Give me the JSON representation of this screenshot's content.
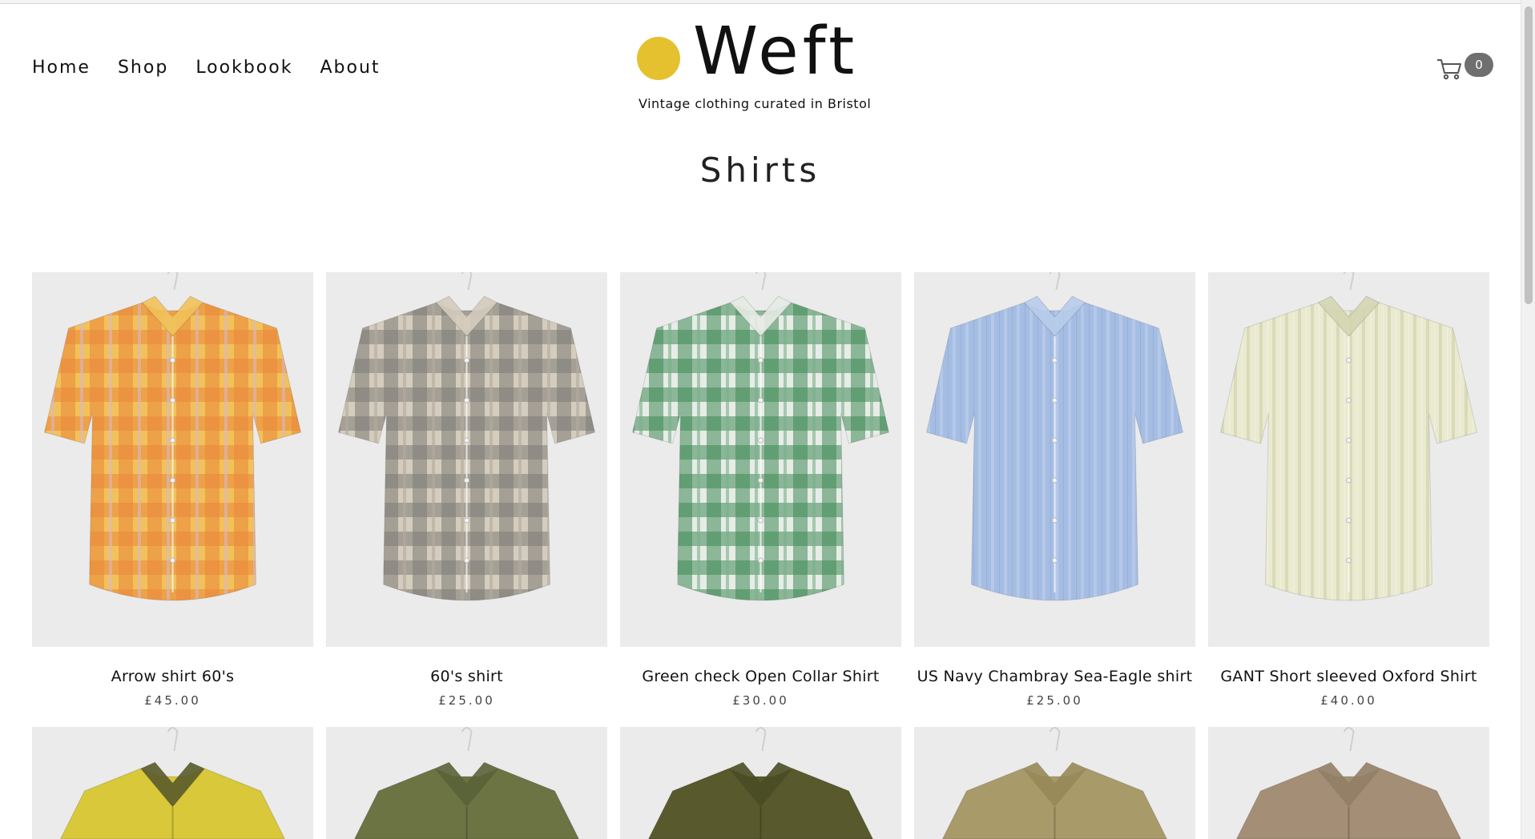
{
  "nav": {
    "items": [
      "Home",
      "Shop",
      "Lookbook",
      "About"
    ]
  },
  "brand": {
    "name": "Weft",
    "tagline": "Vintage clothing curated in Bristol",
    "accent_color": "#e6c12f"
  },
  "cart": {
    "icon": "cart-icon",
    "count": "0"
  },
  "page": {
    "title": "Shirts"
  },
  "products": [
    {
      "name": "Arrow shirt 60's",
      "price": "£45.00",
      "colors": [
        "#e8863a",
        "#f2c25a",
        "#d9b8c8"
      ]
    },
    {
      "name": "60's shirt",
      "price": "£25.00",
      "colors": [
        "#7d7b77",
        "#d4ccbd",
        "#b3ab9e"
      ]
    },
    {
      "name": "Green check Open Collar Shirt",
      "price": "£30.00",
      "colors": [
        "#3f8a55",
        "#e7ece6",
        "#78b08b"
      ]
    },
    {
      "name": "US Navy Chambray Sea-Eagle shirt",
      "price": "£25.00",
      "colors": [
        "#a6bde3",
        "#b8cceb",
        "#93acd6"
      ]
    },
    {
      "name": "GANT Short sleeved Oxford Shirt",
      "price": "£40.00",
      "colors": [
        "#e9ead0",
        "#d4d6b2",
        "#f2f2e2"
      ]
    }
  ],
  "more_products": [
    {
      "colors": [
        "#d8c83a",
        "#5a5a2a"
      ]
    },
    {
      "colors": [
        "#6c7444",
        "#5a6238"
      ]
    },
    {
      "colors": [
        "#58592c",
        "#4a4b24"
      ]
    },
    {
      "colors": [
        "#a99a6a",
        "#968858"
      ]
    },
    {
      "colors": [
        "#a48f76",
        "#927e66"
      ]
    }
  ]
}
